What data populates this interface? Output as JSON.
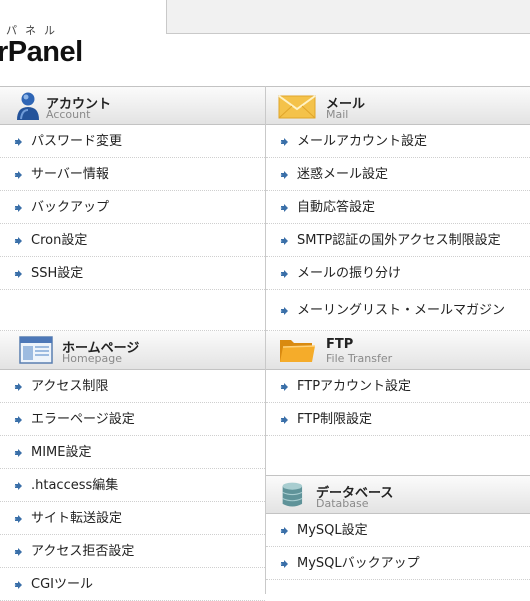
{
  "header": {
    "subtitle": "パネル",
    "title": "rPanel"
  },
  "sections": {
    "account": {
      "title_jp": "アカウント",
      "title_en": "Account",
      "items": [
        "パスワード変更",
        "サーバー情報",
        "バックアップ",
        "Cron設定",
        "SSH設定"
      ]
    },
    "mail": {
      "title_jp": "メール",
      "title_en": "Mail",
      "items": [
        "メールアカウント設定",
        "迷惑メール設定",
        "自動応答設定",
        "SMTP認証の国外アクセス制限設定",
        "メールの振り分け",
        "メーリングリスト・メールマガジン"
      ]
    },
    "website": {
      "title_jp": "ホームページ",
      "title_en": "Homepage",
      "items": [
        "アクセス制限",
        "エラーページ設定",
        "MIME設定",
        ".htaccess編集",
        "サイト転送設定",
        "アクセス拒否設定",
        "CGIツール"
      ]
    },
    "ftp": {
      "title_jp": "FTP",
      "title_en": "File Transfer",
      "items": [
        "FTPアカウント設定",
        "FTP制限設定"
      ]
    },
    "database": {
      "title_jp": "データベース",
      "title_en": "Database",
      "items": [
        "MySQL設定",
        "MySQLバックアップ"
      ]
    }
  },
  "icons": {
    "account": "person-icon",
    "mail": "envelope-icon",
    "website": "browser-window-icon",
    "ftp": "folder-icon",
    "database": "database-icon",
    "item": "arrow-bullet-icon"
  },
  "colors": {
    "arrow": "#3a6fa8",
    "envelope": "#f4c24a",
    "folder": "#f0a020",
    "person": "#2e65b5",
    "database": "#6a9aa0"
  }
}
